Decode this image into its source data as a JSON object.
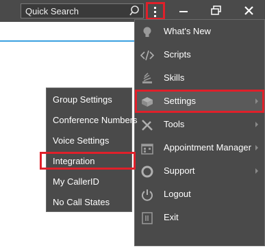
{
  "search": {
    "placeholder": "Quick Search"
  },
  "colors": {
    "bar": "#4a4a4a",
    "highlight": "#e0202a",
    "accent": "#3aa0e0"
  },
  "main_menu": {
    "items": [
      {
        "label": "What's New",
        "icon": "lightbulb-icon"
      },
      {
        "label": "Scripts",
        "icon": "code-icon"
      },
      {
        "label": "Skills",
        "icon": "skills-icon"
      },
      {
        "label": "Settings",
        "icon": "settings-box-icon",
        "has_submenu": true,
        "selected": true
      },
      {
        "label": "Tools",
        "icon": "tools-icon",
        "has_submenu": true
      },
      {
        "label": "Appointment Manager",
        "icon": "calendar-icon",
        "has_submenu": true
      },
      {
        "label": "Support",
        "icon": "lifebuoy-icon",
        "has_submenu": true
      },
      {
        "label": "Logout",
        "icon": "power-icon"
      },
      {
        "label": "Exit",
        "icon": "exit-icon"
      }
    ]
  },
  "settings_submenu": {
    "items": [
      {
        "label": "Group Settings"
      },
      {
        "label": "Conference Numbers"
      },
      {
        "label": "Voice Settings"
      },
      {
        "label": "Integration",
        "selected": true
      },
      {
        "label": "My CallerID"
      },
      {
        "label": "No Call States"
      }
    ]
  }
}
